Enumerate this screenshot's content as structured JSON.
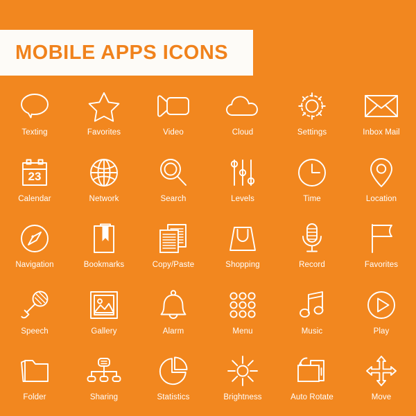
{
  "banner": {
    "title": "MOBILE APPS ICONS"
  },
  "theme": {
    "background": "#F2871F",
    "banner_background": "#FDFBF7",
    "title_color": "#F0821C",
    "icon_color": "#FFFFFF",
    "label_color": "#FFFFFF"
  },
  "calendar": {
    "day_number": "23"
  },
  "grid": {
    "columns": 6,
    "rows": 5,
    "icons": [
      {
        "label": "Texting",
        "icon": "speech-bubble-icon"
      },
      {
        "label": "Favorites",
        "icon": "star-icon"
      },
      {
        "label": "Video",
        "icon": "video-camera-icon"
      },
      {
        "label": "Cloud",
        "icon": "cloud-icon"
      },
      {
        "label": "Settings",
        "icon": "gear-icon"
      },
      {
        "label": "Inbox Mail",
        "icon": "envelope-icon"
      },
      {
        "label": "Calendar",
        "icon": "calendar-icon"
      },
      {
        "label": "Network",
        "icon": "globe-icon"
      },
      {
        "label": "Search",
        "icon": "magnifier-icon"
      },
      {
        "label": "Levels",
        "icon": "sliders-icon"
      },
      {
        "label": "Time",
        "icon": "clock-icon"
      },
      {
        "label": "Location",
        "icon": "map-pin-icon"
      },
      {
        "label": "Navigation",
        "icon": "compass-icon"
      },
      {
        "label": "Bookmarks",
        "icon": "book-bookmark-icon"
      },
      {
        "label": "Copy/Paste",
        "icon": "copy-pages-icon"
      },
      {
        "label": "Shopping",
        "icon": "shopping-bag-icon"
      },
      {
        "label": "Record",
        "icon": "studio-microphone-icon"
      },
      {
        "label": "Favorites",
        "icon": "flag-icon"
      },
      {
        "label": "Speech",
        "icon": "handheld-microphone-icon"
      },
      {
        "label": "Gallery",
        "icon": "picture-frame-icon"
      },
      {
        "label": "Alarm",
        "icon": "bell-icon"
      },
      {
        "label": "Menu",
        "icon": "grid-dots-icon"
      },
      {
        "label": "Music",
        "icon": "music-note-icon"
      },
      {
        "label": "Play",
        "icon": "play-circle-icon"
      },
      {
        "label": "Folder",
        "icon": "folder-icon"
      },
      {
        "label": "Sharing",
        "icon": "share-hierarchy-icon"
      },
      {
        "label": "Statistics",
        "icon": "pie-chart-icon"
      },
      {
        "label": "Brightness",
        "icon": "sun-icon"
      },
      {
        "label": "Auto Rotate",
        "icon": "auto-rotate-icon"
      },
      {
        "label": "Move",
        "icon": "move-arrows-icon"
      }
    ]
  }
}
